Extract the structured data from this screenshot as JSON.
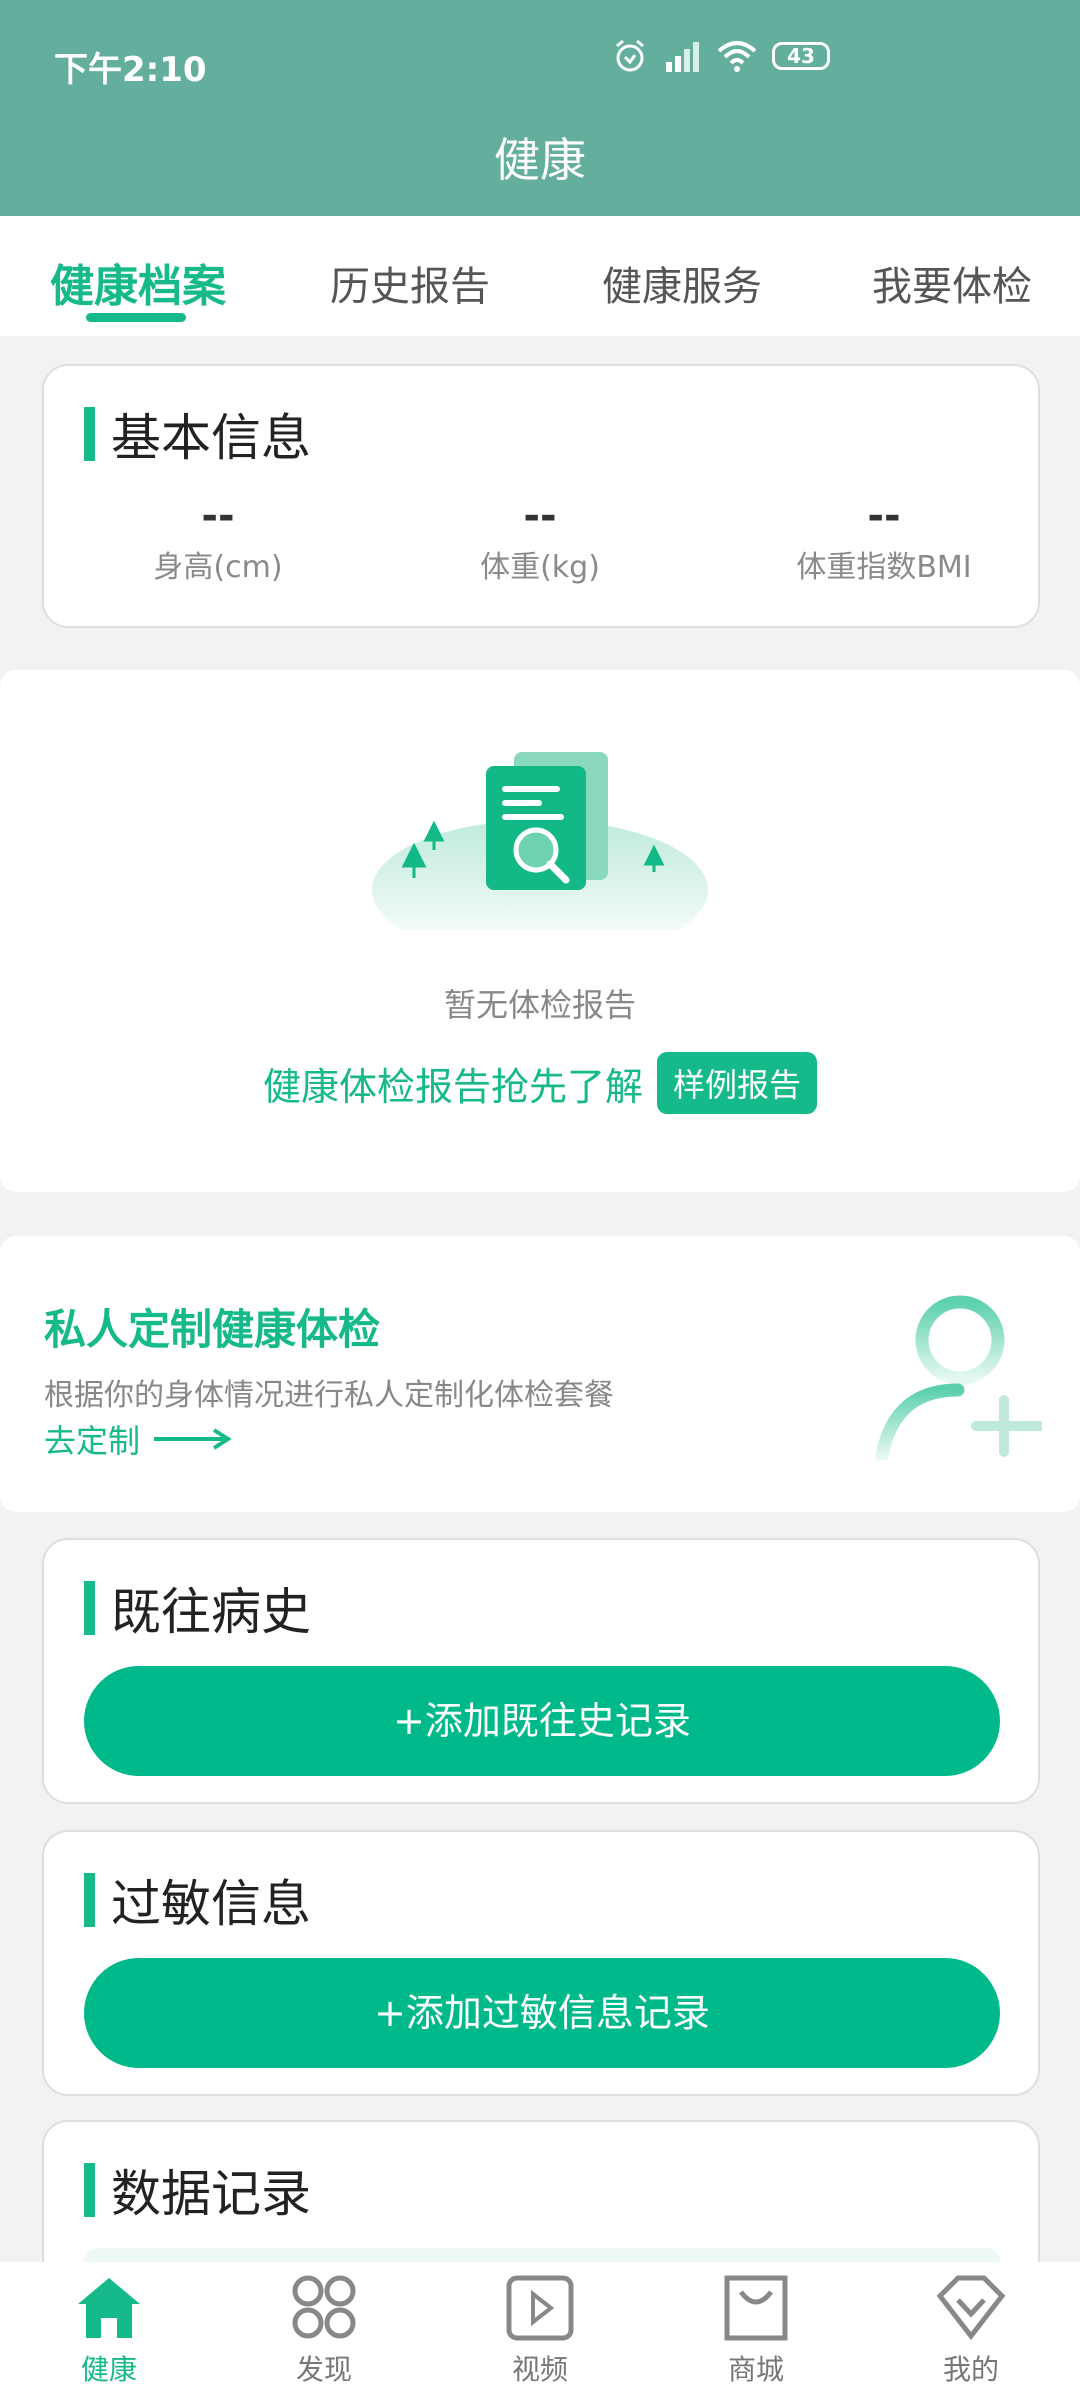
{
  "status_bar": {
    "time": "下午2:10",
    "battery": "43"
  },
  "header": {
    "title": "健康"
  },
  "tabs": [
    {
      "label": "健康档案",
      "active": true
    },
    {
      "label": "历史报告",
      "active": false
    },
    {
      "label": "健康服务",
      "active": false
    },
    {
      "label": "我要体检",
      "active": false
    }
  ],
  "basic_info": {
    "title": "基本信息",
    "metrics": [
      {
        "value": "--",
        "label": "身高(cm)"
      },
      {
        "value": "--",
        "label": "体重(kg)"
      },
      {
        "value": "--",
        "label": "体重指数BMI"
      }
    ]
  },
  "report": {
    "empty_text": "暂无体检报告",
    "promo_text": "健康体检报告抢先了解",
    "sample_button": "样例报告"
  },
  "custom_checkup": {
    "title": "私人定制健康体检",
    "description": "根据你的身体情况进行私人定制化体检套餐",
    "link": "去定制"
  },
  "medical_history": {
    "title": "既往病史",
    "button": "+添加既往史记录"
  },
  "allergy": {
    "title": "过敏信息",
    "button": "+添加过敏信息记录"
  },
  "data_records": {
    "title": "数据记录"
  },
  "bottom_nav": [
    {
      "label": "健康",
      "icon": "home-icon",
      "active": true
    },
    {
      "label": "发现",
      "icon": "discover-icon",
      "active": false
    },
    {
      "label": "视频",
      "icon": "video-icon",
      "active": false
    },
    {
      "label": "商城",
      "icon": "shop-bag-icon",
      "active": false
    },
    {
      "label": "我的",
      "icon": "profile-icon",
      "active": false
    }
  ],
  "colors": {
    "header": "#63ae9c",
    "accent": "#16b98a",
    "button": "#00b98a"
  }
}
